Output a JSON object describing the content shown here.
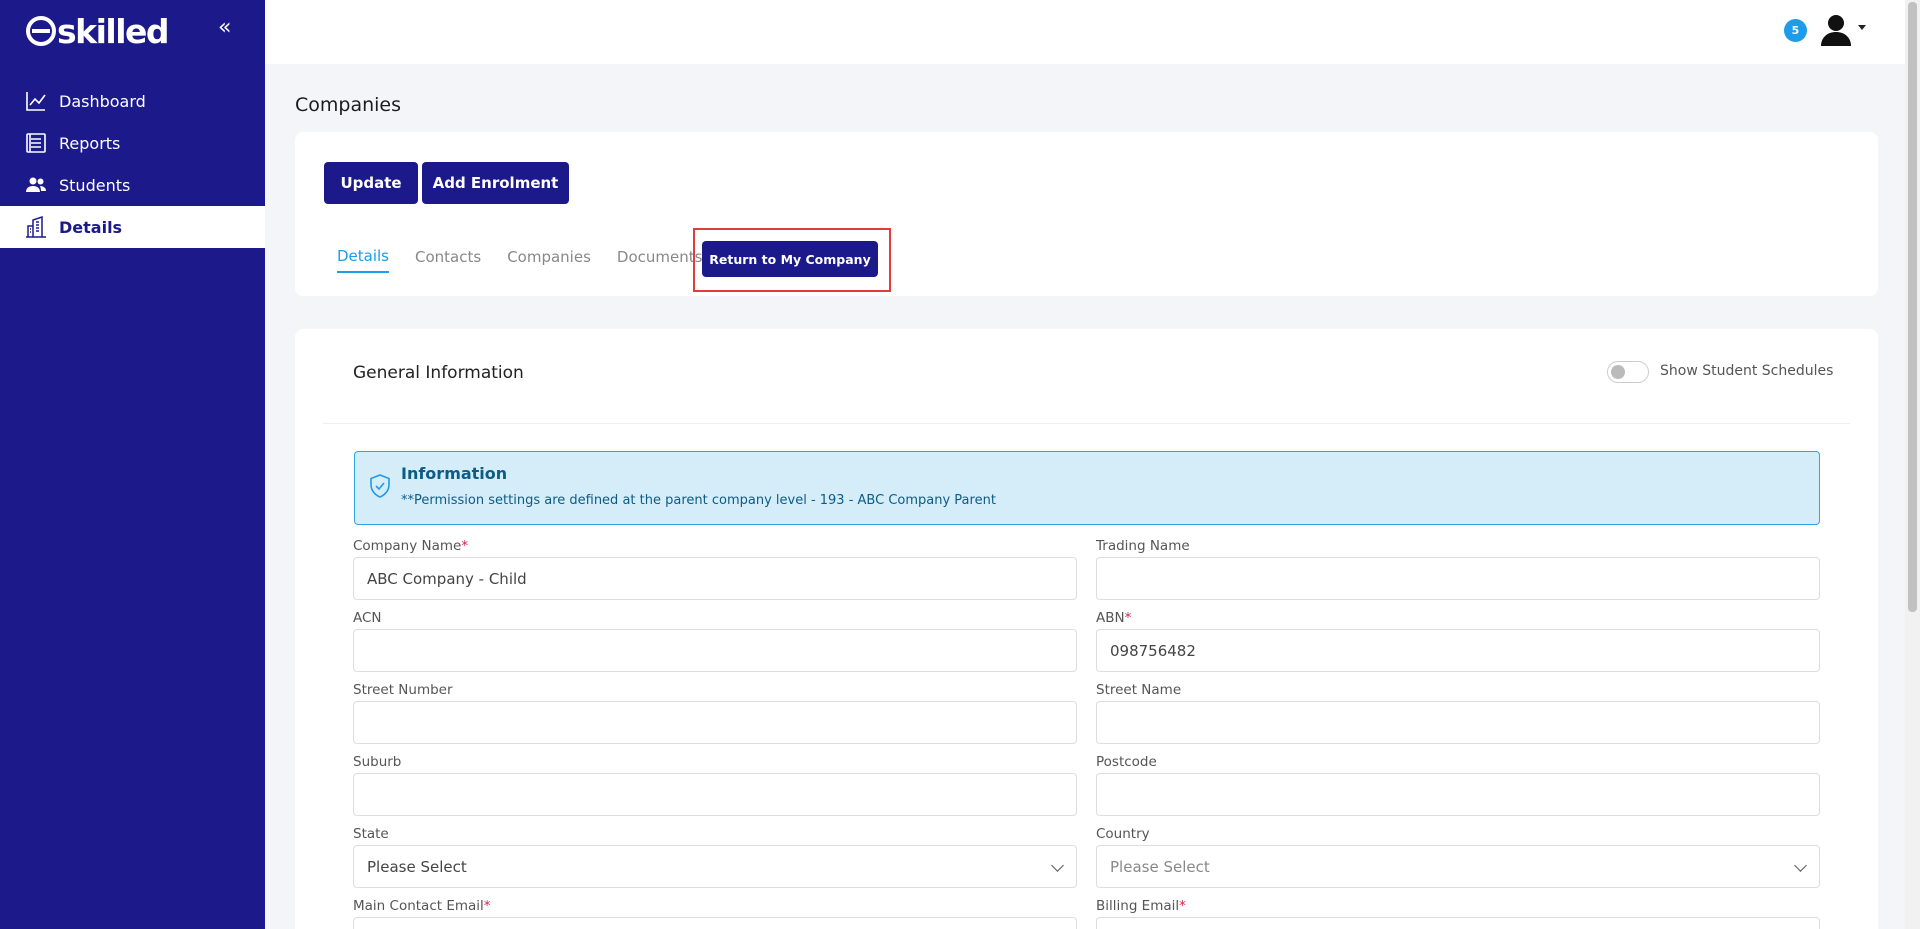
{
  "app": {
    "logo": "skilled",
    "badge_count": "5"
  },
  "sidebar": {
    "items": [
      {
        "label": "Dashboard",
        "icon": "chart-line-icon"
      },
      {
        "label": "Reports",
        "icon": "report-list-icon"
      },
      {
        "label": "Students",
        "icon": "users-icon"
      },
      {
        "label": "Details",
        "icon": "building-icon",
        "active": true
      }
    ]
  },
  "page": {
    "title": "Companies"
  },
  "toolbar": {
    "update_label": "Update",
    "add_enrolment_label": "Add Enrolment"
  },
  "tabs": [
    {
      "label": "Details",
      "active": true
    },
    {
      "label": "Contacts"
    },
    {
      "label": "Companies"
    },
    {
      "label": "Documents"
    }
  ],
  "return_button": {
    "label": "Return to My Company"
  },
  "general": {
    "title": "General Information",
    "toggle_label": "Show Student Schedules",
    "toggle_on": false
  },
  "info": {
    "title": "Information",
    "text": "**Permission settings are defined at the parent company level - 193 - ABC Company Parent"
  },
  "form": {
    "company_name": {
      "label": "Company Name",
      "required": "*",
      "value": "ABC Company - Child"
    },
    "trading_name": {
      "label": "Trading Name",
      "value": ""
    },
    "acn": {
      "label": "ACN",
      "value": ""
    },
    "abn": {
      "label": "ABN",
      "required": "*",
      "value": "098756482"
    },
    "street_number": {
      "label": "Street Number",
      "value": ""
    },
    "street_name": {
      "label": "Street Name",
      "value": ""
    },
    "suburb": {
      "label": "Suburb",
      "value": ""
    },
    "postcode": {
      "label": "Postcode",
      "value": ""
    },
    "state": {
      "label": "State",
      "value": "Please Select"
    },
    "country": {
      "label": "Country",
      "value": "Please Select"
    },
    "main_contact_email": {
      "label": "Main Contact Email",
      "required": "*",
      "value": ""
    },
    "billing_email": {
      "label": "Billing Email",
      "required": "*",
      "value": ""
    }
  },
  "colors": {
    "sidebar": "#1c1a8a",
    "accent": "#1e9be9",
    "highlight": "#e03c3c"
  }
}
